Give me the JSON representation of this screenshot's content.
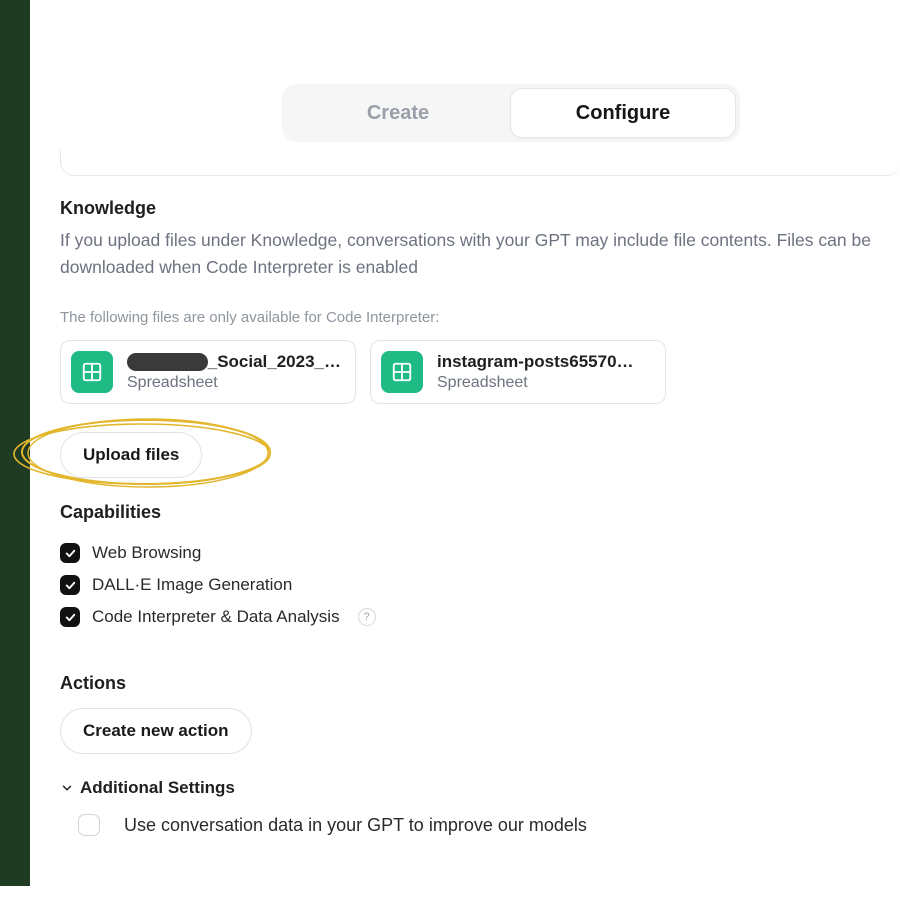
{
  "tabs": {
    "create": "Create",
    "configure": "Configure"
  },
  "knowledge": {
    "heading": "Knowledge",
    "description": "If you upload files under Knowledge, conversations with your GPT may include file contents. Files can be downloaded when Code Interpreter is enabled",
    "code_only_note": "The following files are only available for Code Interpreter:",
    "files": [
      {
        "name_suffix": "_Social_2023_…",
        "type": "Spreadsheet",
        "redacted_prefix": true
      },
      {
        "name": "instagram-posts65570…",
        "type": "Spreadsheet",
        "redacted_prefix": false
      }
    ],
    "upload_label": "Upload files"
  },
  "capabilities": {
    "heading": "Capabilities",
    "items": [
      {
        "label": "Web Browsing",
        "checked": true
      },
      {
        "label": "DALL·E Image Generation",
        "checked": true
      },
      {
        "label": "Code Interpreter & Data Analysis",
        "checked": true,
        "help": "?"
      }
    ]
  },
  "actions": {
    "heading": "Actions",
    "create_label": "Create new action"
  },
  "additional": {
    "heading": "Additional Settings",
    "options": [
      {
        "label": "Use conversation data in your GPT to improve our models",
        "checked": false
      }
    ]
  },
  "colors": {
    "accent_green": "#20bb84",
    "highlight": "#e2b72e"
  }
}
